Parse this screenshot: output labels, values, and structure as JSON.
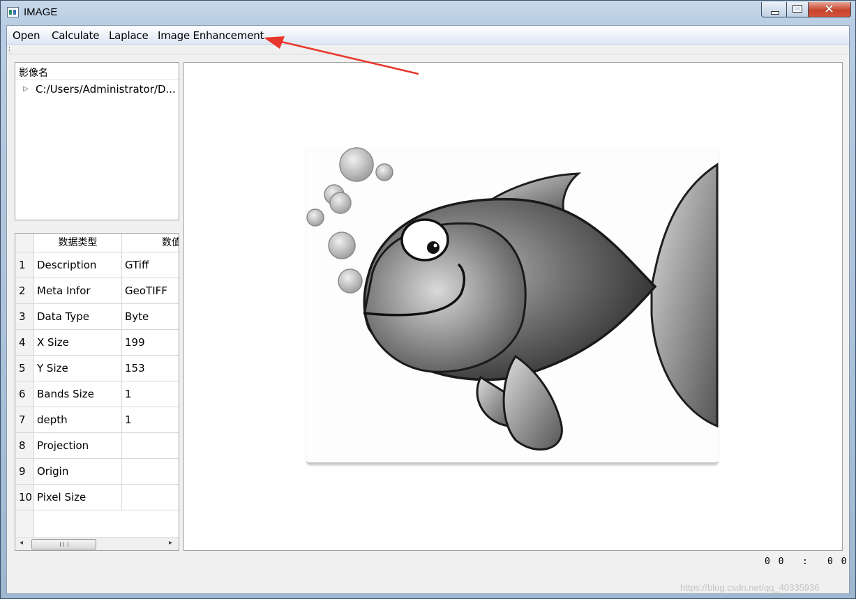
{
  "window": {
    "title": "IMAGE",
    "close_glyph": "✕"
  },
  "menu": {
    "items": [
      "Open",
      "Calculate",
      "Laplace",
      "Image Enhancement"
    ]
  },
  "tree": {
    "header": "影像名",
    "expand_glyph": "▷",
    "item": "C:/Users/Administrator/D..."
  },
  "table": {
    "columns": [
      "数据类型",
      "数值"
    ],
    "rows": [
      {
        "num": "1",
        "type": "Description",
        "value": "GTiff"
      },
      {
        "num": "2",
        "type": "Meta Infor",
        "value": "GeoTIFF"
      },
      {
        "num": "3",
        "type": "Data Type",
        "value": "Byte"
      },
      {
        "num": "4",
        "type": "X Size",
        "value": "199"
      },
      {
        "num": "5",
        "type": "Y Size",
        "value": "153"
      },
      {
        "num": "6",
        "type": "Bands Size",
        "value": "1"
      },
      {
        "num": "7",
        "type": "depth",
        "value": "1"
      },
      {
        "num": "8",
        "type": "Projection",
        "value": ""
      },
      {
        "num": "9",
        "type": "Origin",
        "value": ""
      },
      {
        "num": "10",
        "type": "Pixel Size",
        "value": ""
      }
    ],
    "scroll_left": "◂",
    "scroll_right": "▸"
  },
  "status": {
    "left": "0 0",
    "colon": ":",
    "right": "0 0"
  },
  "watermark": "https://blog.csdn.net/qq_40335936",
  "colors": {
    "annotation_arrow": "#e8372c",
    "close_button": "#c7442c"
  }
}
